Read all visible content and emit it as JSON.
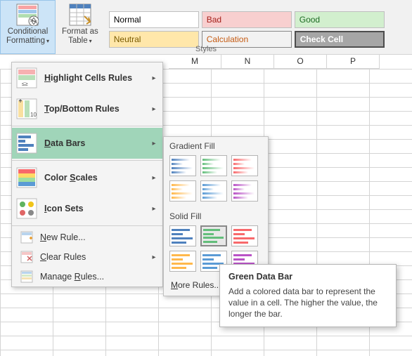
{
  "ribbon": {
    "conditional_formatting_label_l1": "Conditional",
    "conditional_formatting_label_l2": "Formatting",
    "format_as_table_label_l1": "Format as",
    "format_as_table_label_l2": "Table",
    "styles_group_label": "Styles",
    "styles": {
      "normal": "Normal",
      "bad": "Bad",
      "good": "Good",
      "neutral": "Neutral",
      "calculation": "Calculation",
      "check_cell": "Check Cell"
    }
  },
  "columns": [
    "M",
    "N",
    "O",
    "P"
  ],
  "menu": {
    "highlight_cells": "Highlight Cells Rules",
    "top_bottom": "Top/Bottom Rules",
    "data_bars": "Data Bars",
    "color_scales": "Color Scales",
    "icon_sets": "Icon Sets",
    "new_rule": "New Rule...",
    "clear_rules": "Clear Rules",
    "manage_rules": "Manage Rules...",
    "underline": {
      "highlight_cells": "H",
      "top_bottom": "T",
      "data_bars": "D",
      "color_scales": "S",
      "icon_sets": "I",
      "new_rule": "N",
      "clear_rules": "C",
      "manage_rules": "R"
    }
  },
  "submenu": {
    "gradient_fill": "Gradient Fill",
    "solid_fill": "Solid Fill",
    "more_rules": "More Rules...",
    "more_underline": "M",
    "colors": {
      "blue": "#4f81bd",
      "green": "#63be7b",
      "red": "#f8696b",
      "orange": "#ffb84c",
      "lightblue": "#5b9bd5",
      "purple": "#b953c6"
    }
  },
  "tooltip": {
    "title": "Green Data Bar",
    "body": "Add a colored data bar to represent the value in a cell. The higher the value, the longer the bar."
  }
}
